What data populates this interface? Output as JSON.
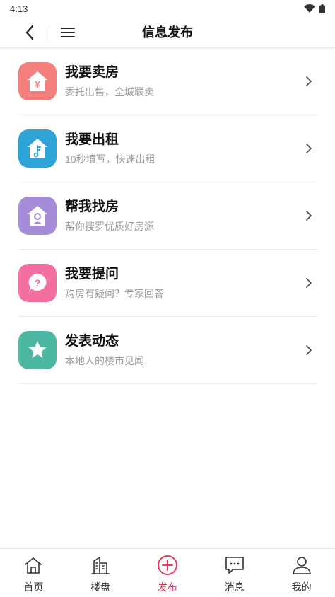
{
  "status_bar": {
    "time": "4:13"
  },
  "header": {
    "title": "信息发布"
  },
  "menu": [
    {
      "title": "我要卖房",
      "subtitle": "委托出售，全城联卖",
      "icon": "house-yen-icon",
      "color": "#f47f7c"
    },
    {
      "title": "我要出租",
      "subtitle": "10秒填写，快速出租",
      "icon": "house-key-icon",
      "color": "#2ea3d6"
    },
    {
      "title": "帮我找房",
      "subtitle": "帮你搜罗优质好房源",
      "icon": "house-search-icon",
      "color": "#a58bd8"
    },
    {
      "title": "我要提问",
      "subtitle": "购房有疑问？专家回答",
      "icon": "question-bubble-icon",
      "color": "#f36ea1"
    },
    {
      "title": "发表动态",
      "subtitle": "本地人的楼市见闻",
      "icon": "star-bubble-icon",
      "color": "#4bb7a3"
    }
  ],
  "tabbar": {
    "active": "发布",
    "accent_color": "#e23c5c",
    "items": [
      {
        "label": "首页",
        "icon": "home-icon"
      },
      {
        "label": "楼盘",
        "icon": "buildings-icon"
      },
      {
        "label": "发布",
        "icon": "plus-circle-icon"
      },
      {
        "label": "消息",
        "icon": "message-icon"
      },
      {
        "label": "我的",
        "icon": "user-icon"
      }
    ]
  }
}
